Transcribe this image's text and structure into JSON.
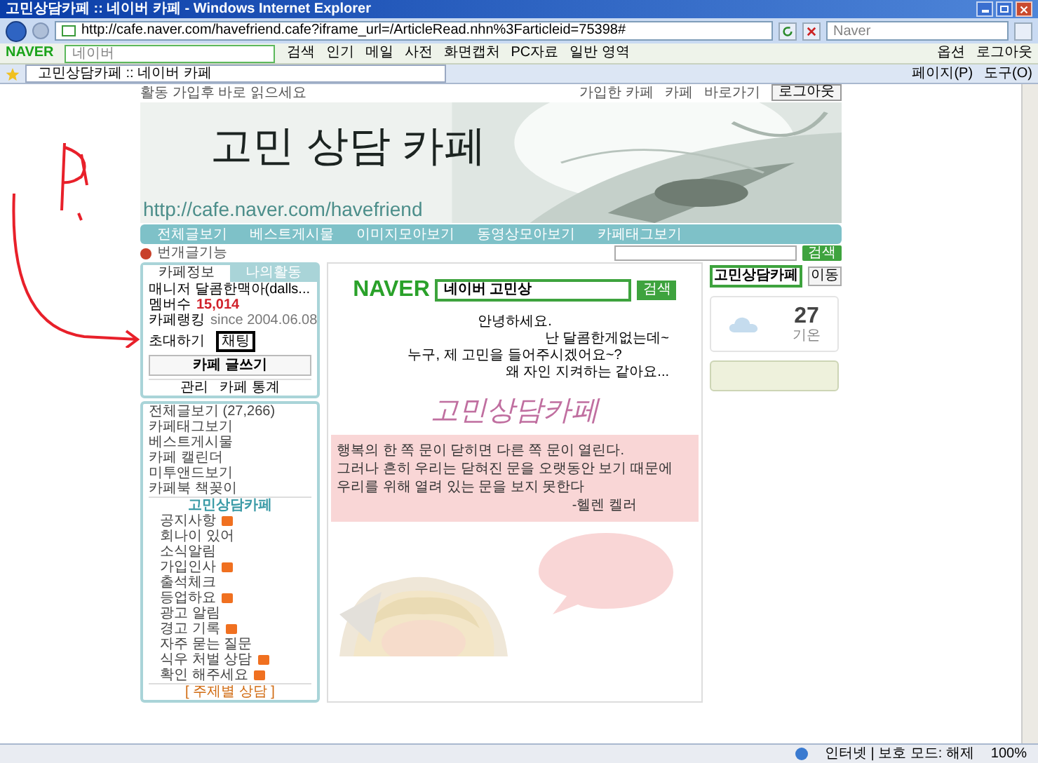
{
  "window": {
    "title": "고민상담카페 :: 네이버 카페 - Windows Internet Explorer"
  },
  "address_bar": {
    "url": "http://cafe.naver.com/havefriend.cafe?iframe_url=/ArticleRead.nhn%3Farticleid=75398#",
    "search_placeholder": "Naver"
  },
  "naver_toolbar": {
    "logo": "NAVER",
    "search_placeholder": "네이버",
    "items": [
      "검색",
      "인기",
      "메일",
      "사전",
      "화면캡처",
      "PC자료",
      "일반 영역"
    ],
    "right_items": [
      "옵션",
      "로그아웃"
    ]
  },
  "tabs": [
    {
      "label": "고민상담카페 :: 네이버 카페",
      "selected": true
    }
  ],
  "command_bar": [
    "페이지(P)",
    "도구(O)"
  ],
  "cafe": {
    "top_notice": "활동 가입후 바로 읽으세요",
    "top_links": [
      "가입한 카페",
      "카페",
      "바로가기"
    ],
    "logout": "로그아웃",
    "banner": {
      "title": "고민 상담 카페",
      "url": "http://cafe.naver.com/havefriend"
    },
    "nav": [
      "전체글보기",
      "베스트게시물",
      "이미지모아보기",
      "동영상모아보기",
      "카페태그보기"
    ],
    "bookmark": "번개글기능",
    "search_button": "검색",
    "sidebar": {
      "tabs": [
        {
          "label": "카페정보",
          "selected": true
        },
        {
          "label": "나의활동",
          "selected": false
        }
      ],
      "manager": "매니저 달콤한맥아(dalls...",
      "members_label": "멤버수",
      "members": "15,014",
      "rank": "카페랭킹",
      "since": "since 2004.06.08",
      "links": [
        {
          "label": "초대하기",
          "marked": false
        },
        {
          "label": "채팅",
          "marked": true
        }
      ],
      "write_button": "카페 글쓰기",
      "admin": [
        "관리",
        "카페 통계"
      ],
      "menus": [
        "전체글보기 (27,266)",
        "카페태그보기",
        "베스트게시물",
        "카페 캘린더",
        "미투앤드보기",
        "카페북 책꽂이"
      ],
      "board_title": "고민상담카페",
      "boards": [
        {
          "label": "공지사항",
          "new": true
        },
        {
          "label": "회나이 있어",
          "new": false
        },
        {
          "label": "소식알림",
          "new": false
        },
        {
          "label": "가입인사",
          "new": true
        },
        {
          "label": "출석체크",
          "new": false
        },
        {
          "label": "등업하요",
          "new": true
        },
        {
          "label": "광고 알림",
          "new": false
        },
        {
          "label": "경고 기록",
          "new": true
        },
        {
          "label": "자주 묻는 질문",
          "new": false
        },
        {
          "label": "식우 처벌 상담",
          "new": true
        },
        {
          "label": "확인 해주세요",
          "new": true
        }
      ],
      "footer": "[ 주제별 상담 ]"
    },
    "article": {
      "logo": "NAVER",
      "search_value": "네이버 고민상",
      "search_button": "검색",
      "intro": [
        "안녕하세요.",
        "난 달콤한게없는데~",
        "누구, 제 고민을 들어주시겠어요~?",
        "왜 자인 지켜하는 같아요..."
      ],
      "cafe_logo": "고민상담카페",
      "quote": [
        "행복의 한 쪽 문이 닫히면 다른 쪽 문이 열린다.",
        "그러나 흔히 우리는 닫혀진 문을 오랫동안 보기 때문에",
        "우리를 위해 열려 있는 문을 보지 못한다"
      ],
      "quote_author": "-헬렌 켈러"
    },
    "right": {
      "select": "고민상담카페",
      "go_button": "이동",
      "temperature": "27",
      "weather_label": "기온"
    }
  },
  "status_bar": {
    "zone": "인터넷 | 보호 모드: 해제",
    "zoom": "100%"
  }
}
